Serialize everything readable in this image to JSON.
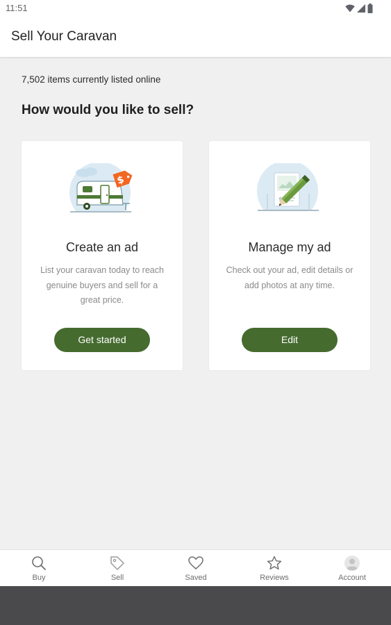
{
  "status_bar": {
    "time": "11:51",
    "icons": [
      "wifi-icon",
      "signal-icon",
      "battery-icon"
    ]
  },
  "app_bar": {
    "title": "Sell Your Caravan"
  },
  "main": {
    "listed_count": "7,502 items currently listed online",
    "heading": "How would you like to sell?",
    "cards": [
      {
        "title": "Create an ad",
        "description": "List your caravan today to reach genuine buyers and sell for a great price.",
        "button_label": "Get started",
        "illustration": "caravan-price-tag-illustration",
        "tag_symbol": "$"
      },
      {
        "title": "Manage my ad",
        "description": "Check out your ad, edit details or add photos at any time.",
        "button_label": "Edit",
        "illustration": "edit-ad-pencil-illustration",
        "doc_symbol": "$"
      }
    ]
  },
  "bottom_nav": {
    "items": [
      {
        "label": "Buy",
        "icon": "search-icon"
      },
      {
        "label": "Sell",
        "icon": "tag-icon",
        "active": true
      },
      {
        "label": "Saved",
        "icon": "heart-icon"
      },
      {
        "label": "Reviews",
        "icon": "star-icon"
      },
      {
        "label": "Account",
        "icon": "avatar-icon"
      }
    ]
  },
  "colors": {
    "brand_green": "#456b2f",
    "accent_orange": "#f26722",
    "background": "#f0f0f0"
  }
}
